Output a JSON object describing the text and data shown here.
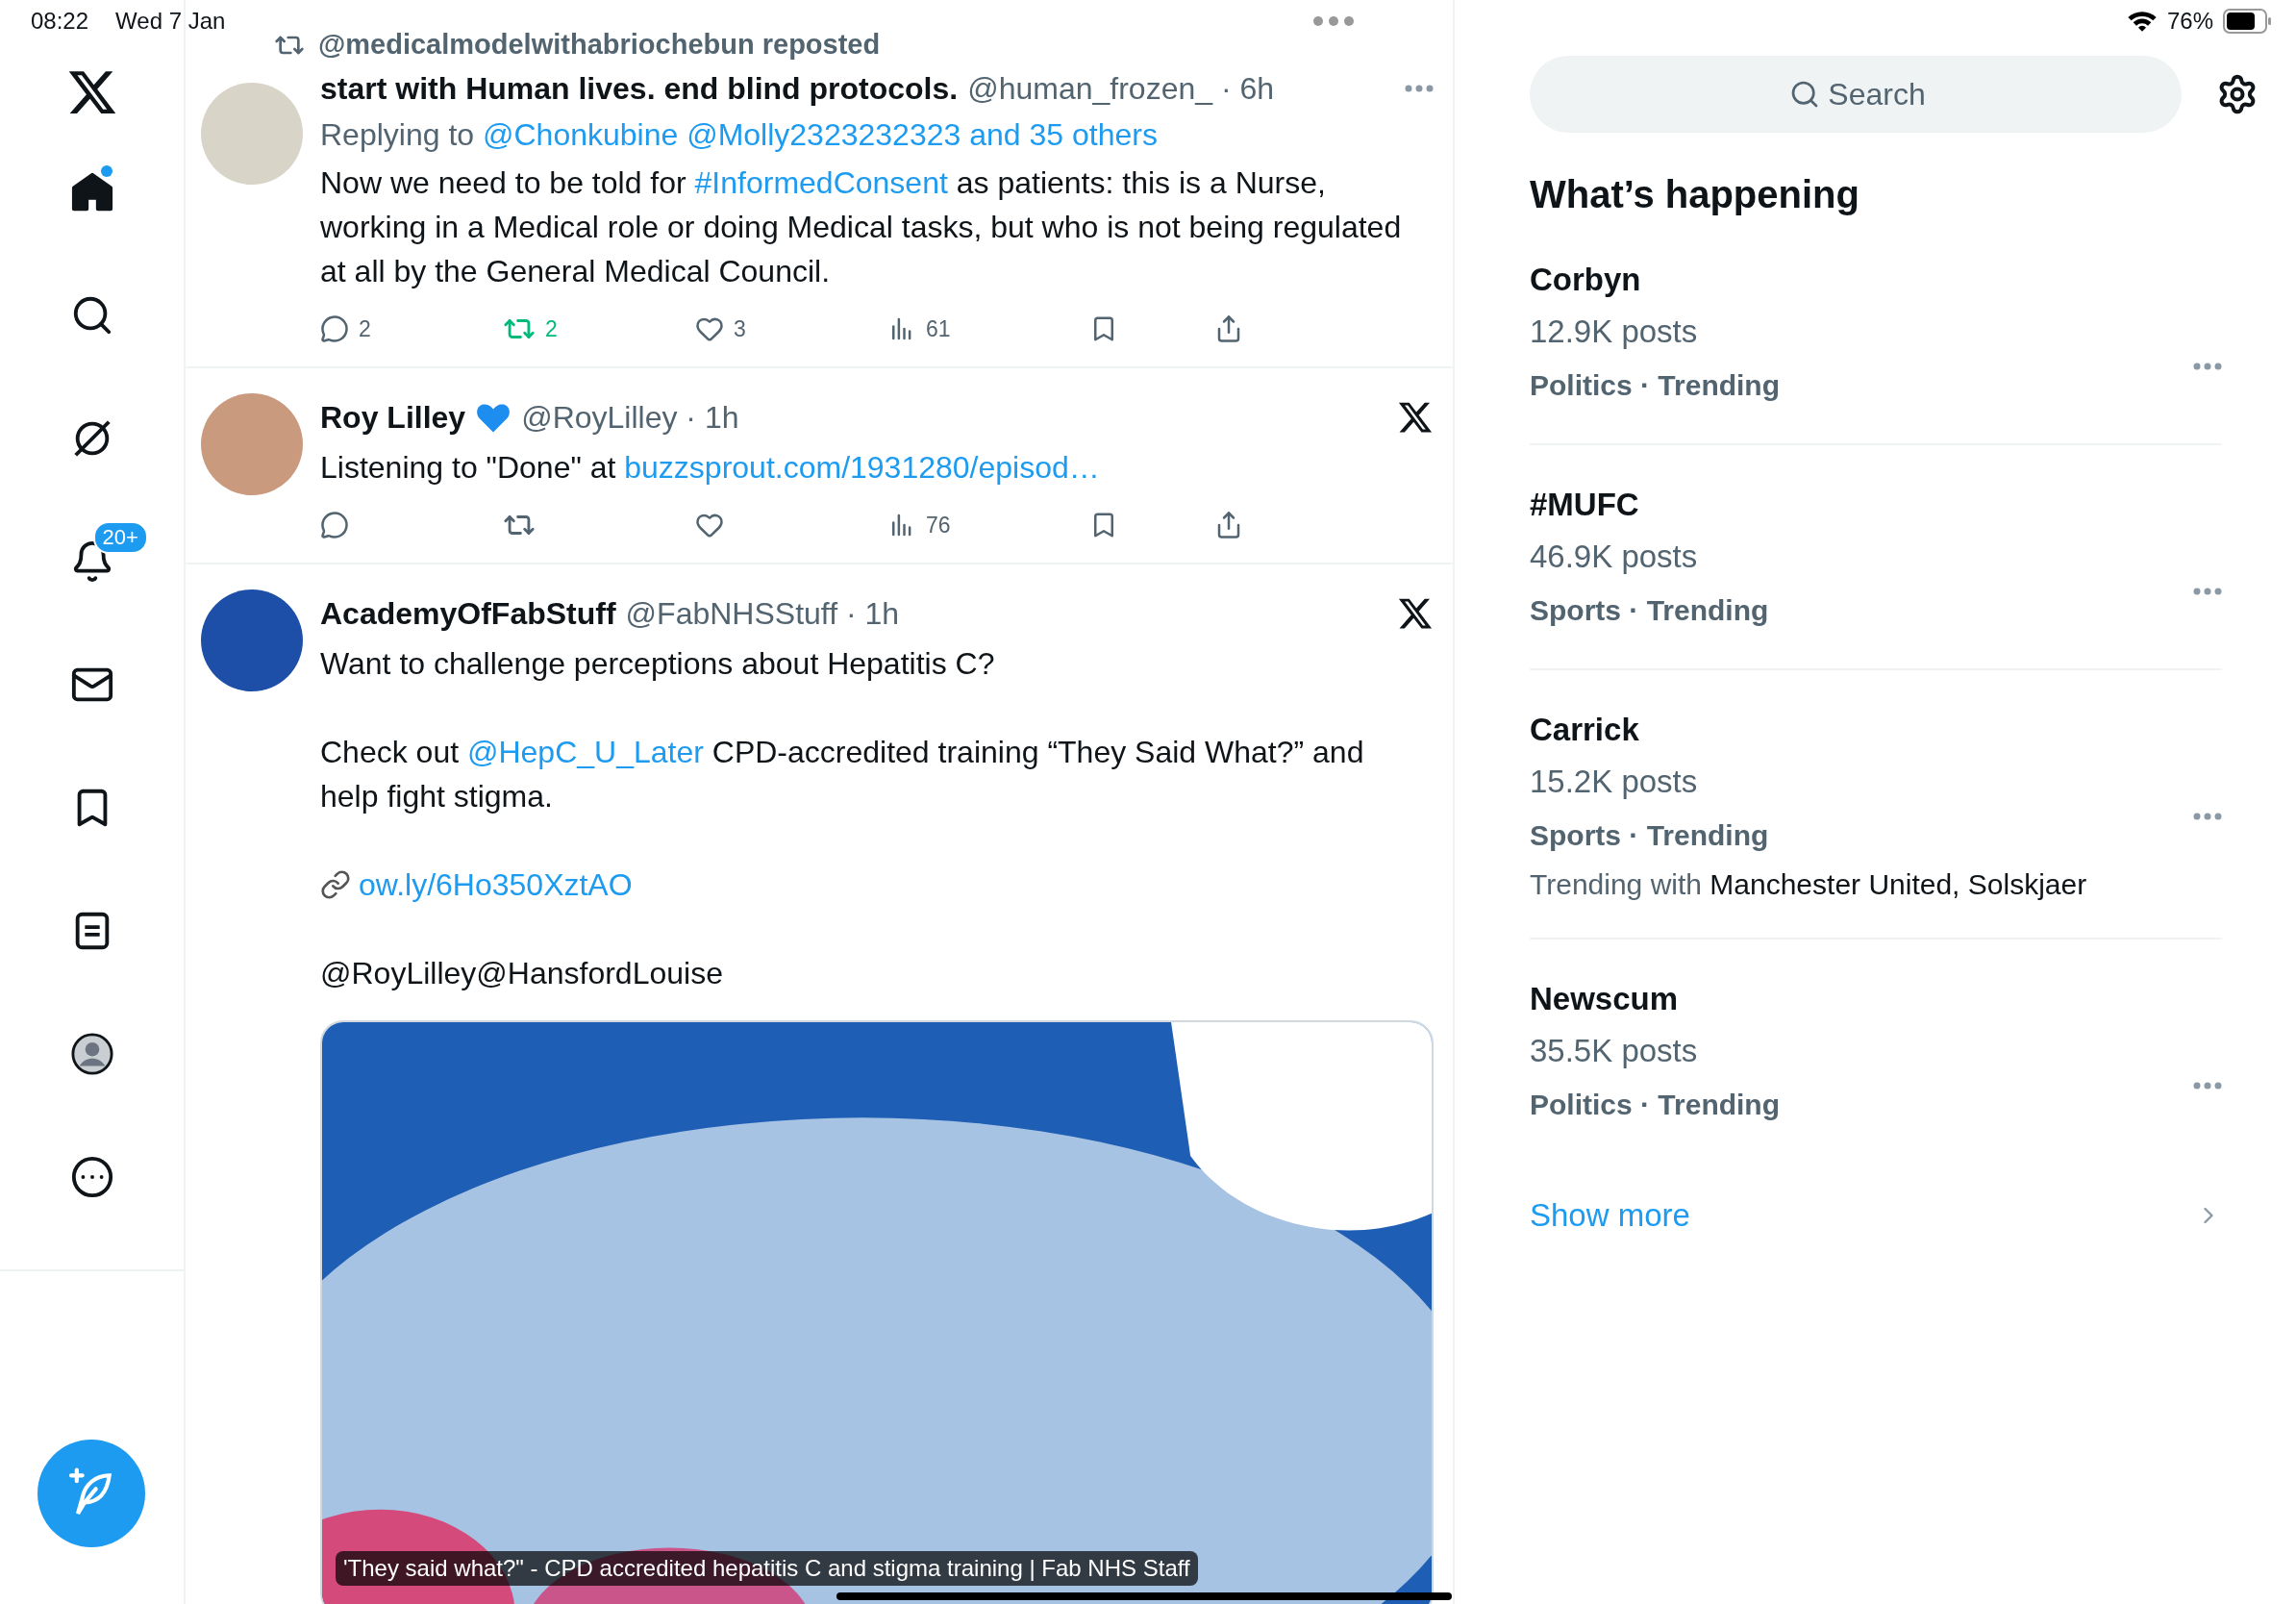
{
  "status_bar": {
    "time": "08:22",
    "date": "Wed 7 Jan",
    "battery": "76%"
  },
  "nav": {
    "items": [
      {
        "kind": "logo"
      },
      {
        "kind": "home",
        "selected": true,
        "unread": true
      },
      {
        "kind": "search",
        "selected": false
      },
      {
        "kind": "grok",
        "selected": false
      },
      {
        "kind": "notifications",
        "selected": false,
        "badge": "20+"
      },
      {
        "kind": "messages",
        "selected": false
      },
      {
        "kind": "bookmarks",
        "selected": false
      },
      {
        "kind": "lists",
        "selected": false
      },
      {
        "kind": "profile",
        "selected": false
      },
      {
        "kind": "more",
        "selected": false
      }
    ]
  },
  "tweets": [
    {
      "repost_by": "@medicalmodelwithabriochebun reposted",
      "name": "start with Human lives. end blind protocols.",
      "meta": "@human_frozen_ · 6h",
      "menu": {
        "kind": "more"
      },
      "reply_to": {
        "prefix": "Replying to",
        "mentions": "@Chonkubine @Molly2323232323 and 35 others"
      },
      "paragraphs": [
        [
          {
            "text": "Now we need to be told for ",
            "link": false
          },
          {
            "text": "#InformedConsent",
            "link": true
          },
          {
            "text": " as patients:  this is a Nurse, working in a Medical role or doing Medical tasks, but who is not being regulated at all by the General Medical Council.",
            "link": false
          }
        ]
      ],
      "actions": {
        "replies": "2",
        "reposts": "2",
        "reposted": true,
        "likes": "3",
        "views": "61"
      }
    },
    {
      "name": "Roy Lilley",
      "name_emoji": {
        "kind": "heart"
      },
      "meta": "@RoyLilley · 1h",
      "menu": {
        "kind": "x"
      },
      "paragraphs": [
        [
          {
            "text": "Listening to \"Done\" at ",
            "link": false
          },
          {
            "text": "buzzsprout.com/1931280/episod…",
            "link": true
          }
        ]
      ],
      "actions": {
        "reposted": false,
        "views": "76"
      }
    },
    {
      "name": "AcademyOfFabStuff",
      "meta": "@FabNHSStuff · 1h",
      "menu": {
        "kind": "x"
      },
      "paragraphs": [
        [
          {
            "text": "Want to challenge perceptions about Hepatitis C?",
            "link": false
          }
        ],
        [
          {
            "text": "Check out ",
            "link": false
          },
          {
            "text": "@HepC_U_Later",
            "link": true
          },
          {
            "text": " CPD-accredited training “They Said What?” and help fight stigma.",
            "link": false
          }
        ],
        [
          {
            "kind": "link-emoji"
          },
          {
            "text": "ow.ly/6Ho350XztAO",
            "link": true
          }
        ],
        [
          {
            "text": "@RoyLilley@HansfordLouise",
            "link": false
          }
        ]
      ],
      "media": {
        "caption": "'They said what?\" - CPD accredited hepatitis C and stigma training | Fab NHS Staff"
      }
    }
  ],
  "sidebar": {
    "search": {
      "placeholder": "Search"
    },
    "title": "What’s happening",
    "trends": [
      {
        "name": "Corbyn",
        "posts": "12.9K posts",
        "category": "Politics · Trending"
      },
      {
        "name": "#MUFC",
        "posts": "46.9K posts",
        "category": "Sports · Trending"
      },
      {
        "name": "Carrick",
        "posts": "15.2K posts",
        "category": "Sports · Trending",
        "trending_with": {
          "prefix": "Trending with",
          "names": "Manchester United, Solskjaer"
        }
      },
      {
        "name": "Newscum",
        "posts": "35.5K posts",
        "category": "Politics · Trending"
      }
    ],
    "show_more": "Show more"
  }
}
